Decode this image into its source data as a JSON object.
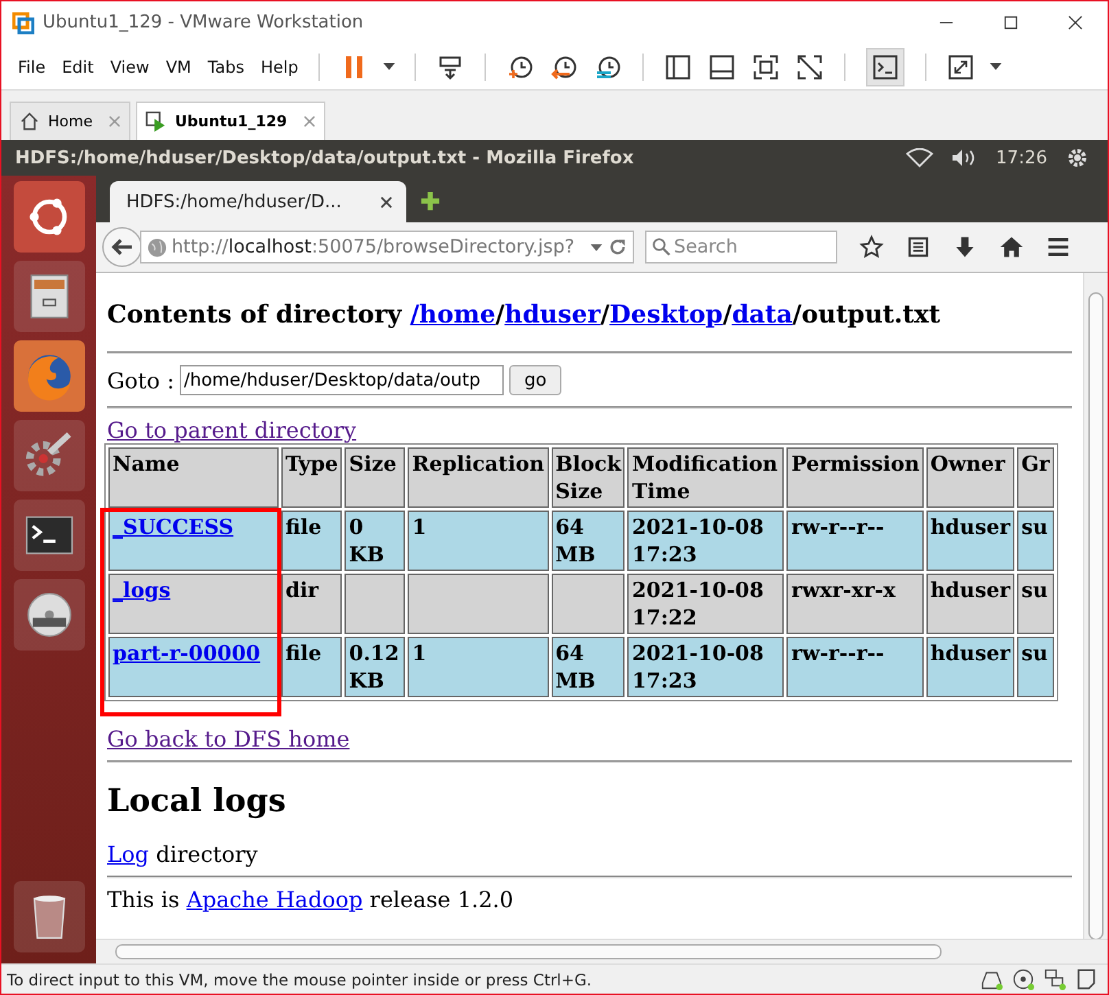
{
  "window": {
    "title": "Ubuntu1_129 - VMware Workstation"
  },
  "menu": [
    "File",
    "Edit",
    "View",
    "VM",
    "Tabs",
    "Help"
  ],
  "vm_tabs": [
    {
      "label": "Home",
      "selected": false
    },
    {
      "label": "Ubuntu1_129",
      "selected": true
    }
  ],
  "ubuntu_bar": {
    "title": "HDFS:/home/hduser/Desktop/data/output.txt - Mozilla Firefox",
    "clock": "17:26"
  },
  "browser": {
    "tab": "HDFS:/home/hduser/D...",
    "url_scheme": "http://",
    "url_host": "localhost",
    "url_rest": ":50075/browseDirectory.jsp?",
    "search_placeholder": "Search"
  },
  "page": {
    "heading": [
      {
        "text": "Contents of directory ",
        "link": false
      },
      {
        "text": "/home",
        "link": true
      },
      {
        "text": "/",
        "link": false
      },
      {
        "text": "hduser",
        "link": true
      },
      {
        "text": "/",
        "link": false
      },
      {
        "text": "Desktop",
        "link": true
      },
      {
        "text": "/",
        "link": false
      },
      {
        "text": "data",
        "link": true
      },
      {
        "text": "/output.txt",
        "link": false
      }
    ],
    "goto_label": "Goto :",
    "goto_value": "/home/hduser/Desktop/data/outp",
    "go_button": "go",
    "parent_link": {
      "text": "Go to parent directory",
      "visited": true
    },
    "table": {
      "columns": [
        "Name",
        "Type",
        "Size",
        "Replication",
        "Block Size",
        "Modification Time",
        "Permission",
        "Owner",
        "Gr"
      ],
      "rows": [
        {
          "color": "#add8e6",
          "cells": [
            "_SUCCESS",
            "file",
            "0 KB",
            "1",
            "64 MB",
            "2021-10-08 17:23",
            "rw-r--r--",
            "hduser",
            "su"
          ]
        },
        {
          "color": "#d3d3d3",
          "cells": [
            "_logs",
            "dir",
            "",
            "",
            "",
            "2021-10-08 17:22",
            "rwxr-xr-x",
            "hduser",
            "su"
          ]
        },
        {
          "color": "#add8e6",
          "cells": [
            "part-r-00000",
            "file",
            "0.12 KB",
            "1",
            "64 MB",
            "2021-10-08 17:23",
            "rw-r--r--",
            "hduser",
            "su"
          ]
        }
      ]
    },
    "home_link": {
      "text": "Go back to DFS home",
      "visited": true
    },
    "logs_heading": "Local logs",
    "log_line": [
      {
        "text": "Log",
        "link": true
      },
      {
        "text": " directory",
        "link": false
      }
    ],
    "footer": [
      {
        "text": "This is ",
        "link": false
      },
      {
        "text": "Apache Hadoop",
        "link": true
      },
      {
        "text": " release 1.2.0",
        "link": false
      }
    ]
  },
  "status_bar": "To direct input to this VM, move the mouse pointer inside or press Ctrl+G."
}
